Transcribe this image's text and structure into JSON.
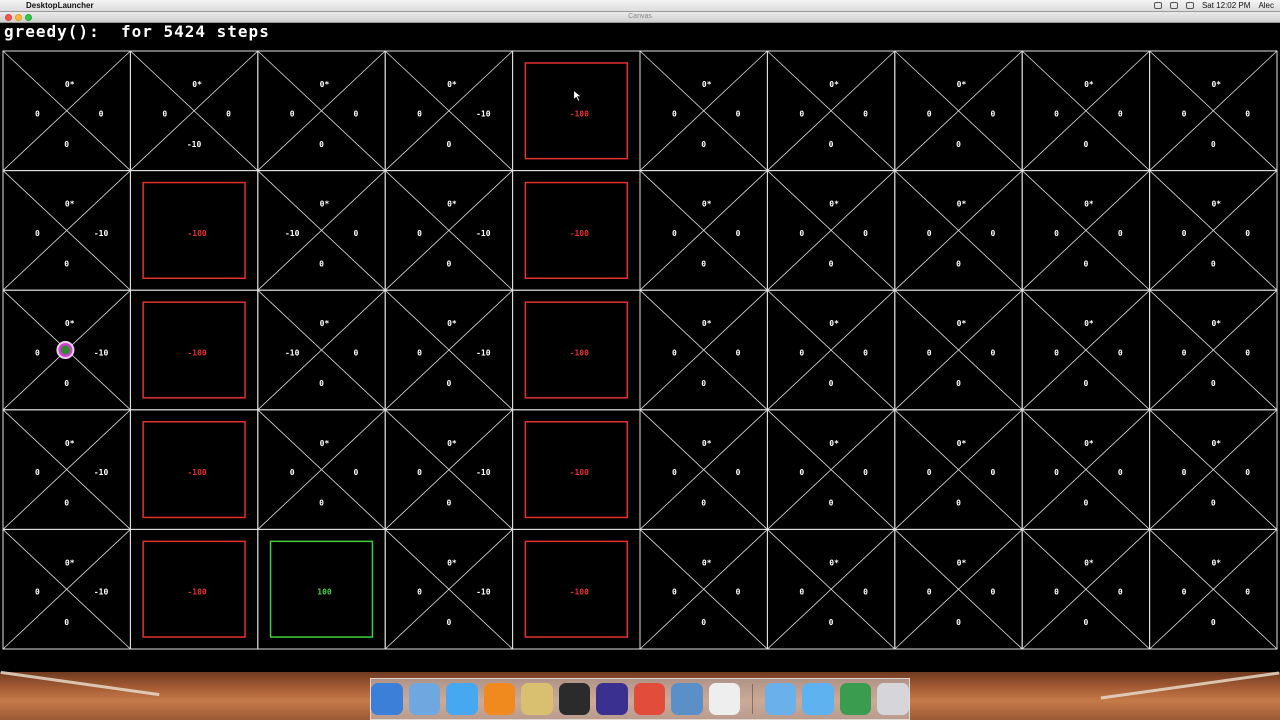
{
  "menubar": {
    "apple": "",
    "app_name": "DesktopLauncher",
    "clock": "Sat 12:02 PM",
    "user": "Alec"
  },
  "window": {
    "title": "Canvas"
  },
  "status_line": "greedy():  for 5424 steps",
  "grid": {
    "cols": 10,
    "rows": 5,
    "line_color": "#e0e0e0",
    "bad_color": "#e53030",
    "goal_color": "#3cd23c",
    "text_color": "#ffffff",
    "agent_color": "#d040d0",
    "agent": {
      "row": 2,
      "col": 0,
      "label": "0"
    },
    "cursor": {
      "row": 0,
      "col": 4
    },
    "cells": [
      [
        {
          "t": "q",
          "n": "0*",
          "w": "0",
          "e": "0",
          "s": "0"
        },
        {
          "t": "q",
          "n": "0*",
          "w": "0",
          "e": "0",
          "s": "-10"
        },
        {
          "t": "q",
          "n": "0*",
          "w": "0",
          "e": "0",
          "s": "0"
        },
        {
          "t": "q",
          "n": "0*",
          "w": "0",
          "e": "-10",
          "s": "0"
        },
        {
          "t": "bad",
          "v": "-100"
        },
        {
          "t": "q",
          "n": "0*",
          "w": "0",
          "e": "0",
          "s": "0"
        },
        {
          "t": "q",
          "n": "0*",
          "w": "0",
          "e": "0",
          "s": "0"
        },
        {
          "t": "q",
          "n": "0*",
          "w": "0",
          "e": "0",
          "s": "0"
        },
        {
          "t": "q",
          "n": "0*",
          "w": "0",
          "e": "0",
          "s": "0"
        },
        {
          "t": "q",
          "n": "0*",
          "w": "0",
          "e": "0",
          "s": "0"
        }
      ],
      [
        {
          "t": "q",
          "n": "0*",
          "w": "0",
          "e": "-10",
          "s": "0"
        },
        {
          "t": "bad",
          "v": "-100"
        },
        {
          "t": "q",
          "n": "0*",
          "w": "-10",
          "e": "0",
          "s": "0"
        },
        {
          "t": "q",
          "n": "0*",
          "w": "0",
          "e": "-10",
          "s": "0"
        },
        {
          "t": "bad",
          "v": "-100"
        },
        {
          "t": "q",
          "n": "0*",
          "w": "0",
          "e": "0",
          "s": "0"
        },
        {
          "t": "q",
          "n": "0*",
          "w": "0",
          "e": "0",
          "s": "0"
        },
        {
          "t": "q",
          "n": "0*",
          "w": "0",
          "e": "0",
          "s": "0"
        },
        {
          "t": "q",
          "n": "0*",
          "w": "0",
          "e": "0",
          "s": "0"
        },
        {
          "t": "q",
          "n": "0*",
          "w": "0",
          "e": "0",
          "s": "0"
        }
      ],
      [
        {
          "t": "q",
          "n": "0*",
          "w": "0",
          "e": "-10",
          "s": "0"
        },
        {
          "t": "bad",
          "v": "-100"
        },
        {
          "t": "q",
          "n": "0*",
          "w": "-10",
          "e": "0",
          "s": "0"
        },
        {
          "t": "q",
          "n": "0*",
          "w": "0",
          "e": "-10",
          "s": "0"
        },
        {
          "t": "bad",
          "v": "-100"
        },
        {
          "t": "q",
          "n": "0*",
          "w": "0",
          "e": "0",
          "s": "0"
        },
        {
          "t": "q",
          "n": "0*",
          "w": "0",
          "e": "0",
          "s": "0"
        },
        {
          "t": "q",
          "n": "0*",
          "w": "0",
          "e": "0",
          "s": "0"
        },
        {
          "t": "q",
          "n": "0*",
          "w": "0",
          "e": "0",
          "s": "0"
        },
        {
          "t": "q",
          "n": "0*",
          "w": "0",
          "e": "0",
          "s": "0"
        }
      ],
      [
        {
          "t": "q",
          "n": "0*",
          "w": "0",
          "e": "-10",
          "s": "0"
        },
        {
          "t": "bad",
          "v": "-100"
        },
        {
          "t": "q",
          "n": "0*",
          "w": "0",
          "e": "0",
          "s": "0"
        },
        {
          "t": "q",
          "n": "0*",
          "w": "0",
          "e": "-10",
          "s": "0"
        },
        {
          "t": "bad",
          "v": "-100"
        },
        {
          "t": "q",
          "n": "0*",
          "w": "0",
          "e": "0",
          "s": "0"
        },
        {
          "t": "q",
          "n": "0*",
          "w": "0",
          "e": "0",
          "s": "0"
        },
        {
          "t": "q",
          "n": "0*",
          "w": "0",
          "e": "0",
          "s": "0"
        },
        {
          "t": "q",
          "n": "0*",
          "w": "0",
          "e": "0",
          "s": "0"
        },
        {
          "t": "q",
          "n": "0*",
          "w": "0",
          "e": "0",
          "s": "0"
        }
      ],
      [
        {
          "t": "q",
          "n": "0*",
          "w": "0",
          "e": "-10",
          "s": "0"
        },
        {
          "t": "bad",
          "v": "-100"
        },
        {
          "t": "goal",
          "v": "100"
        },
        {
          "t": "q",
          "n": "0*",
          "w": "0",
          "e": "-10",
          "s": "0"
        },
        {
          "t": "bad",
          "v": "-100"
        },
        {
          "t": "q",
          "n": "0*",
          "w": "0",
          "e": "0",
          "s": "0"
        },
        {
          "t": "q",
          "n": "0*",
          "w": "0",
          "e": "0",
          "s": "0"
        },
        {
          "t": "q",
          "n": "0*",
          "w": "0",
          "e": "0",
          "s": "0"
        },
        {
          "t": "q",
          "n": "0*",
          "w": "0",
          "e": "0",
          "s": "0"
        },
        {
          "t": "q",
          "n": "0*",
          "w": "0",
          "e": "0",
          "s": "0"
        }
      ]
    ]
  },
  "dock": {
    "items": [
      {
        "name": "finder-icon",
        "color": "#3b7fd8"
      },
      {
        "name": "preview-icon",
        "color": "#6fa7e0"
      },
      {
        "name": "messages-icon",
        "color": "#45a8f0"
      },
      {
        "name": "vlc-icon",
        "color": "#f08a1e"
      },
      {
        "name": "scissors-icon",
        "color": "#d8c070"
      },
      {
        "name": "terminal-icon",
        "color": "#2b2b2b"
      },
      {
        "name": "eclipse-icon",
        "color": "#3a3090"
      },
      {
        "name": "chrome-icon",
        "color": "#e24c3a"
      },
      {
        "name": "network-icon",
        "color": "#5a8fc8"
      },
      {
        "name": "java-icon",
        "color": "#eeeeee"
      },
      {
        "name": "sep",
        "color": ""
      },
      {
        "name": "folder-icon",
        "color": "#6ab0ea"
      },
      {
        "name": "screen-icon",
        "color": "#5fb2f0"
      },
      {
        "name": "spreadsheet-icon",
        "color": "#3a9c4e"
      },
      {
        "name": "trash-icon",
        "color": "#d6d6da"
      }
    ]
  }
}
